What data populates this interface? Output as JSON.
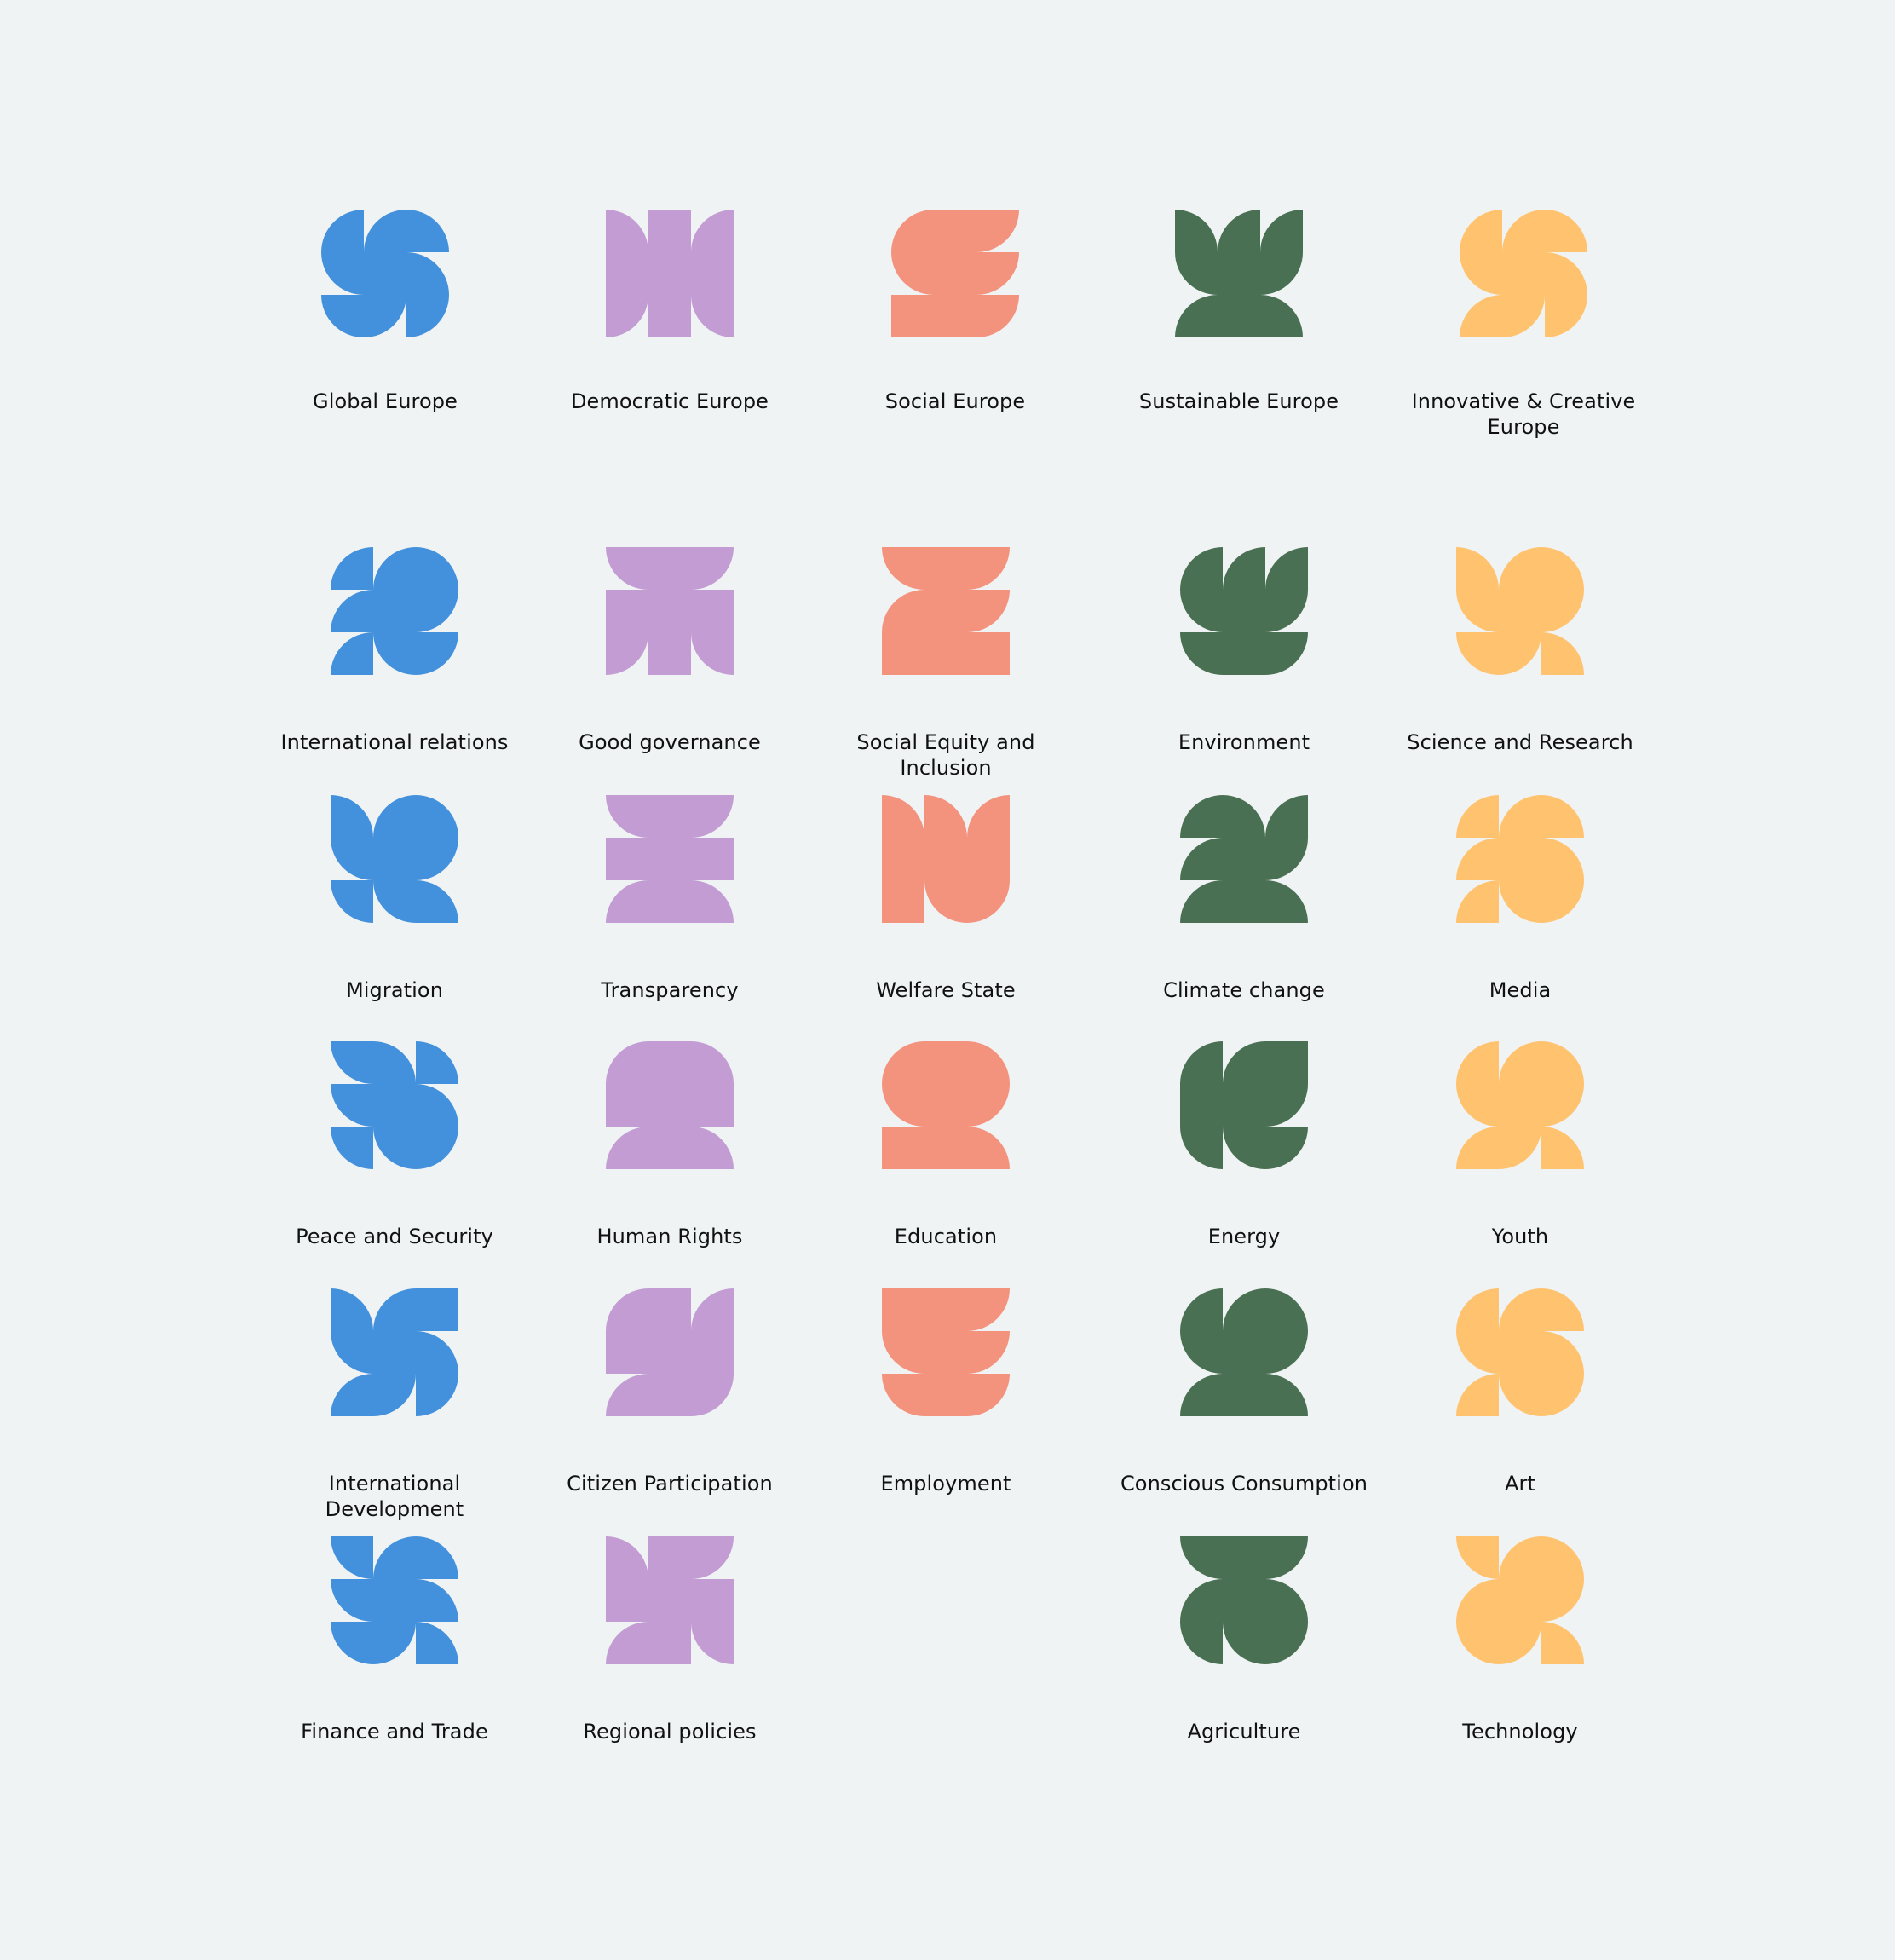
{
  "colors": {
    "blue": "#4390dc",
    "purple": "#c39cd3",
    "salmon": "#f3937e",
    "green": "#4a7053",
    "yellow": "#ffc36f",
    "background": "#eff3f4",
    "text": "#111111"
  },
  "categories": [
    {
      "label": "Global Europe",
      "color": "blue",
      "pattern": [
        "TL",
        "TL",
        "TR",
        "BL",
        "S",
        "TR",
        "BL",
        "BR",
        "BR"
      ]
    },
    {
      "label": "Democratic Europe",
      "color": "purple",
      "pattern": [
        "TR",
        "S",
        "TL",
        "S",
        "S",
        "S",
        "BR",
        "S",
        "BL"
      ]
    },
    {
      "label": "Social Europe",
      "color": "salmon",
      "pattern": [
        "TL",
        "S",
        "BR",
        "BL",
        "S",
        "BR",
        "S",
        "S",
        "BR"
      ]
    },
    {
      "label": "Sustainable Europe",
      "color": "green",
      "pattern": [
        "TR",
        "TL",
        "TL",
        "BL",
        "S",
        "BR",
        "TL",
        "S",
        "TR"
      ]
    },
    {
      "label": "Innovative & Creative Europe",
      "color": "yellow",
      "pattern": [
        "TL",
        "TL",
        "TR",
        "BL",
        "S",
        "TR",
        "TL",
        "BR",
        "BR"
      ]
    }
  ],
  "topics": [
    [
      {
        "label": "International relations",
        "color": "blue",
        "pattern": [
          "TL",
          "TL",
          "TR",
          "TL",
          "S",
          "BR",
          "TL",
          "BL",
          "BR"
        ]
      },
      {
        "label": "Good governance",
        "color": "purple",
        "pattern": [
          "BL",
          "S",
          "BR",
          "S",
          "S",
          "S",
          "BR",
          "S",
          "BL"
        ]
      },
      {
        "label": "Social Equity and Inclusion",
        "color": "salmon",
        "pattern": [
          "BL",
          "S",
          "BR",
          "TL",
          "S",
          "BR",
          "S",
          "S",
          "S"
        ]
      },
      {
        "label": "Environment",
        "color": "green",
        "pattern": [
          "TL",
          "TL",
          "TL",
          "BL",
          "S",
          "BR",
          "BL",
          "S",
          "BR"
        ]
      },
      {
        "label": "Science and Research",
        "color": "yellow",
        "pattern": [
          "TR",
          "TL",
          "TR",
          "BL",
          "S",
          "BR",
          "BL",
          "BR",
          "TR"
        ]
      }
    ],
    [
      {
        "label": "Migration",
        "color": "blue",
        "pattern": [
          "TR",
          "TL",
          "TR",
          "BL",
          "S",
          "BR",
          "BL",
          "BL",
          "TR"
        ]
      },
      {
        "label": "Transparency",
        "color": "purple",
        "pattern": [
          "BL",
          "S",
          "BR",
          "S",
          "S",
          "S",
          "TL",
          "S",
          "TR"
        ]
      },
      {
        "label": "Welfare State",
        "color": "salmon",
        "pattern": [
          "TR",
          "TR",
          "TL",
          "S",
          "S",
          "S",
          "S",
          "BL",
          "BR"
        ]
      },
      {
        "label": "Climate change",
        "color": "green",
        "pattern": [
          "TL",
          "TR",
          "TL",
          "TL",
          "S",
          "BR",
          "TL",
          "S",
          "TR"
        ]
      },
      {
        "label": "Media",
        "color": "yellow",
        "pattern": [
          "TL",
          "TL",
          "TR",
          "TL",
          "S",
          "TR",
          "TL",
          "BL",
          "BR"
        ]
      }
    ],
    [
      {
        "label": "Peace and Security",
        "color": "blue",
        "pattern": [
          "BL",
          "TR",
          "TR",
          "BL",
          "S",
          "TR",
          "BL",
          "BL",
          "BR"
        ]
      },
      {
        "label": "Human Rights",
        "color": "purple",
        "pattern": [
          "TL",
          "S",
          "TR",
          "S",
          "S",
          "S",
          "TL",
          "S",
          "TR"
        ]
      },
      {
        "label": "Education",
        "color": "salmon",
        "pattern": [
          "TL",
          "S",
          "TR",
          "BL",
          "S",
          "BR",
          "S",
          "S",
          "TR"
        ]
      },
      {
        "label": "Energy",
        "color": "green",
        "pattern": [
          "TL",
          "TL",
          "S",
          "S",
          "S",
          "BR",
          "BL",
          "BL",
          "BR"
        ]
      },
      {
        "label": "Youth",
        "color": "yellow",
        "pattern": [
          "TL",
          "TL",
          "TR",
          "BL",
          "S",
          "BR",
          "TL",
          "BR",
          "TR"
        ]
      }
    ],
    [
      {
        "label": "International Development",
        "color": "blue",
        "pattern": [
          "TR",
          "TL",
          "S",
          "BL",
          "S",
          "TR",
          "TL",
          "BR",
          "BR"
        ]
      },
      {
        "label": "Citizen Participation",
        "color": "purple",
        "pattern": [
          "TL",
          "S",
          "TL",
          "S",
          "S",
          "S",
          "TL",
          "S",
          "BR"
        ]
      },
      {
        "label": "Employment",
        "color": "salmon",
        "pattern": [
          "S",
          "S",
          "BR",
          "BL",
          "S",
          "BR",
          "BL",
          "S",
          "BR"
        ]
      },
      {
        "label": "Conscious Consumption",
        "color": "green",
        "pattern": [
          "TL",
          "TL",
          "TR",
          "BL",
          "S",
          "BR",
          "TL",
          "S",
          "TR"
        ]
      },
      {
        "label": "Art",
        "color": "yellow",
        "pattern": [
          "TL",
          "TL",
          "TR",
          "BL",
          "S",
          "TR",
          "TL",
          "BL",
          "BR"
        ]
      }
    ],
    [
      {
        "label": "Finance and Trade",
        "color": "blue",
        "pattern": [
          "BL",
          "TL",
          "TR",
          "BL",
          "S",
          "TR",
          "BL",
          "BR",
          "TR"
        ]
      },
      {
        "label": "Regional policies",
        "color": "purple",
        "pattern": [
          "TR",
          "S",
          "BR",
          "S",
          "S",
          "S",
          "TL",
          "S",
          "BL"
        ]
      },
      null,
      {
        "label": "Agriculture",
        "color": "green",
        "pattern": [
          "BL",
          "S",
          "BR",
          "TL",
          "S",
          "TR",
          "BL",
          "BL",
          "BR"
        ]
      },
      {
        "label": "Technology",
        "color": "yellow",
        "pattern": [
          "BL",
          "TL",
          "TR",
          "TL",
          "S",
          "BR",
          "BL",
          "BR",
          "TR"
        ]
      }
    ]
  ]
}
